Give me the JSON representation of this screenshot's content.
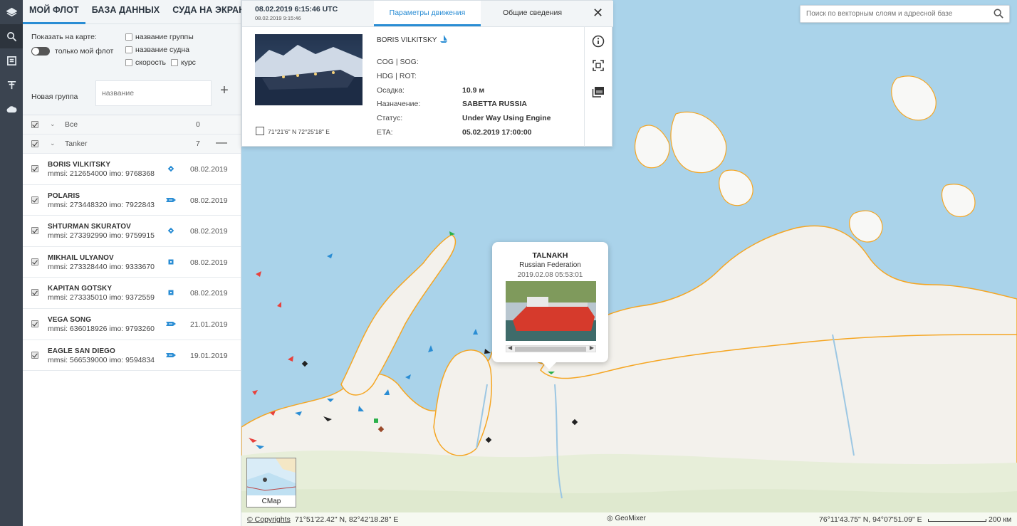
{
  "fleet": {
    "tabs": [
      "МОЙ ФЛОТ",
      "БАЗА ДАННЫХ",
      "СУДА НА ЭКРАНЕ"
    ],
    "show_on_map_label": "Показать на карте:",
    "only_my_fleet_label": "только мой флот",
    "options": [
      "название группы",
      "название судна",
      "скорость",
      "курс"
    ],
    "new_group_label": "Новая группа",
    "new_group_placeholder": "название",
    "groups": [
      {
        "name": "Все",
        "count": "0"
      },
      {
        "name": "Tanker",
        "count": "7"
      }
    ],
    "vessels": [
      {
        "name": "BORIS VILKITSKY",
        "sub": "mmsi: 212654000 imo: 9768368",
        "date": "08.02.2019",
        "icon": "diamond-icon"
      },
      {
        "name": "POLARIS",
        "sub": "mmsi: 273448320 imo: 7922843",
        "date": "08.02.2019",
        "icon": "ship-arrow-icon"
      },
      {
        "name": "SHTURMAN SKURATOV",
        "sub": "mmsi: 273392990 imo: 9759915",
        "date": "08.02.2019",
        "icon": "diamond-icon"
      },
      {
        "name": "MIKHAIL ULYANOV",
        "sub": "mmsi: 273328440 imo: 9333670",
        "date": "08.02.2019",
        "icon": "square-icon"
      },
      {
        "name": "KAPITAN GOTSKY",
        "sub": "mmsi: 273335010 imo: 9372559",
        "date": "08.02.2019",
        "icon": "square-icon"
      },
      {
        "name": "VEGA SONG",
        "sub": "mmsi: 636018926 imo: 9793260",
        "date": "21.01.2019",
        "icon": "ship-arrow-icon"
      },
      {
        "name": "EAGLE SAN DIEGO",
        "sub": "mmsi: 566539000 imo: 9594834",
        "date": "19.01.2019",
        "icon": "ship-arrow-icon"
      }
    ]
  },
  "card": {
    "timestamp_utc": "08.02.2019 6:15:46 UTC",
    "timestamp_local": "08.02.2019 9:15:46",
    "tabs": [
      "Параметры движения",
      "Общие сведения"
    ],
    "ship_name": "BORIS VILKITSKY",
    "coords": "71°21'6\" N 72°25'18\" E",
    "fields": [
      {
        "label": "COG | SOG:",
        "value": ""
      },
      {
        "label": "HDG | ROT:",
        "value": ""
      },
      {
        "label": "Осадка:",
        "value": "10.9 м"
      },
      {
        "label": "Назначение:",
        "value": "SABETTA RUSSIA"
      },
      {
        "label": "Статус:",
        "value": "Under Way Using Engine"
      },
      {
        "label": "ETA:",
        "value": "05.02.2019 17:00:00"
      }
    ]
  },
  "search": {
    "placeholder": "Поиск по векторным слоям и адресной базе"
  },
  "popup": {
    "name": "TALNAKH",
    "country": "Russian Federation",
    "date": "2019.02.08 05:53:01"
  },
  "minimap": {
    "label": "CMap"
  },
  "bottombar": {
    "copyrights": "© Copyrights",
    "mouse_coords": "71°51'22.42\" N, 82°42'18.28\" E",
    "brand": "GeoMixer",
    "center_coords": "76°11'43.75\" N, 94°07'51.09\" E",
    "scale_label": "200 км"
  },
  "colors": {
    "accent": "#2a8dd4",
    "sea": "#aad3ea",
    "land": "#f4f2ee",
    "coast": "#f5a623"
  }
}
